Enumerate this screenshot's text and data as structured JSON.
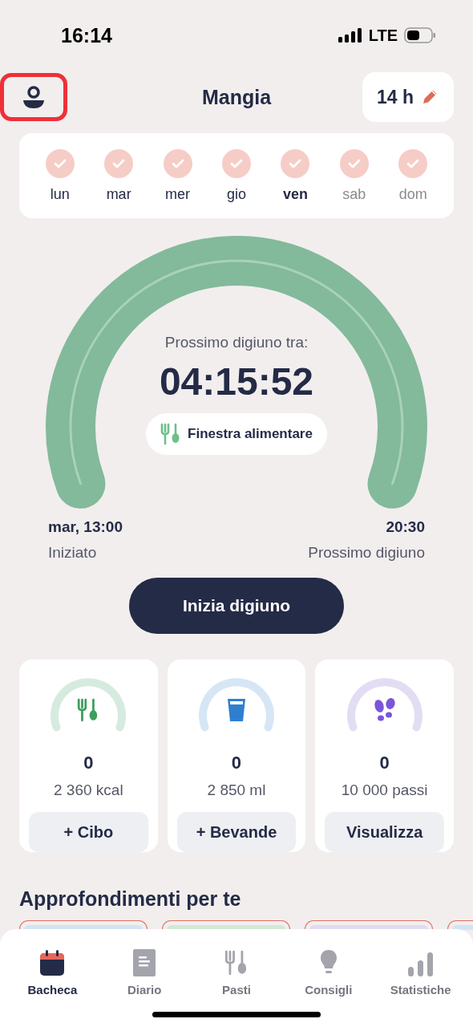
{
  "status_bar": {
    "time": "16:14",
    "network": "LTE"
  },
  "header": {
    "title": "Mangia",
    "fasting_hours": "14 h"
  },
  "week": [
    {
      "label": "lun",
      "done": true,
      "selected": false,
      "future": false
    },
    {
      "label": "mar",
      "done": true,
      "selected": false,
      "future": false
    },
    {
      "label": "mer",
      "done": true,
      "selected": false,
      "future": false
    },
    {
      "label": "gio",
      "done": true,
      "selected": false,
      "future": false
    },
    {
      "label": "ven",
      "done": true,
      "selected": true,
      "future": false
    },
    {
      "label": "sab",
      "done": true,
      "selected": false,
      "future": true
    },
    {
      "label": "dom",
      "done": true,
      "selected": false,
      "future": true
    }
  ],
  "timer": {
    "caption": "Prossimo digiuno tra:",
    "countdown": "04:15:52",
    "phase_label": "Finestra alimentare",
    "start": {
      "time": "mar, 13:00",
      "label": "Iniziato"
    },
    "end": {
      "time": "20:30",
      "label": "Prossimo digiuno"
    }
  },
  "primary_button": "Inizia digiuno",
  "trackers": [
    {
      "kind": "food",
      "value": "0",
      "goal": "2 360 kcal",
      "button": "+ Cibo"
    },
    {
      "kind": "water",
      "value": "0",
      "goal": "2 850 ml",
      "button": "+ Bevande"
    },
    {
      "kind": "steps",
      "value": "0",
      "goal": "10 000 passi",
      "button": "Visualizza"
    }
  ],
  "insights": {
    "title": "Approfondimenti per te",
    "cards": [
      {
        "color": "#d3e4f4"
      },
      {
        "color": "#d3e8d6"
      },
      {
        "color": "#e0daf2"
      },
      {
        "color": "#d3e4f4"
      }
    ]
  },
  "tab_bar": [
    {
      "kind": "calendar",
      "label": "Bacheca",
      "selected": true
    },
    {
      "kind": "document",
      "label": "Diario",
      "selected": false
    },
    {
      "kind": "cutlery",
      "label": "Pasti",
      "selected": false
    },
    {
      "kind": "bulb",
      "label": "Consigli",
      "selected": false
    },
    {
      "kind": "bars",
      "label": "Statistiche",
      "selected": false
    }
  ]
}
